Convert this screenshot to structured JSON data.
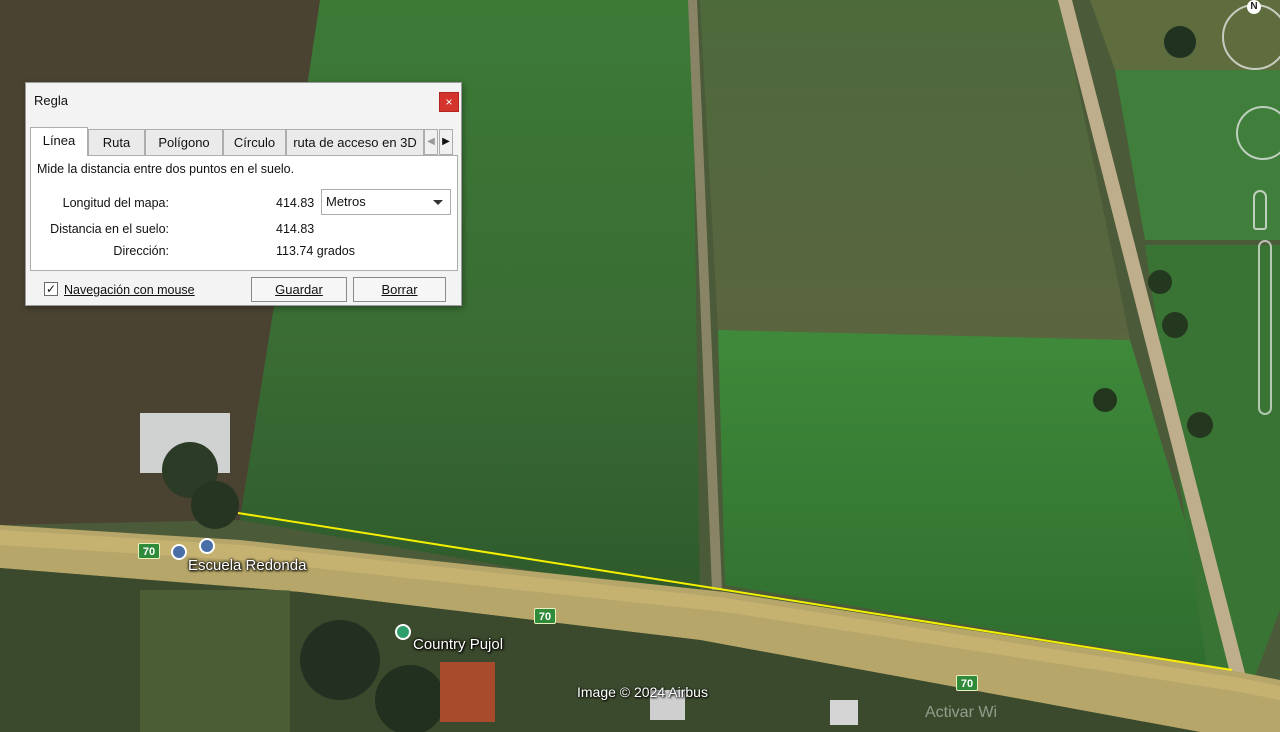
{
  "dialog": {
    "title": "Regla",
    "close_glyph": "×",
    "tabs": [
      {
        "label": "Línea",
        "active": true
      },
      {
        "label": "Ruta",
        "active": false
      },
      {
        "label": "Polígono",
        "active": false
      },
      {
        "label": "Círculo",
        "active": false
      },
      {
        "label": "ruta de acceso en 3D",
        "active": false
      }
    ],
    "tab_scroll_left": "◀",
    "tab_scroll_right": "▶",
    "description": "Mide la distancia entre dos puntos en el suelo.",
    "map_length_label": "Longitud del mapa:",
    "map_length_value": "414.83",
    "unit_selected": "Metros",
    "ground_distance_label": "Distancia en el suelo:",
    "ground_distance_value": "414.83",
    "direction_label": "Dirección:",
    "direction_value": "113.74 grados",
    "mouse_nav_label": "Navegación con mouse",
    "mouse_nav_checked": true,
    "check_glyph": "✓",
    "save_button": "Guardar",
    "clear_button": "Borrar"
  },
  "map": {
    "labels": {
      "school": "Escuela Redonda",
      "country": "Country Pujol",
      "credit": "Image © 2024 Airbus",
      "activate_watermark": "Activar Wi"
    },
    "route_number": "70",
    "compass_letter": "N",
    "ruler_line_color": "#f5f000"
  }
}
